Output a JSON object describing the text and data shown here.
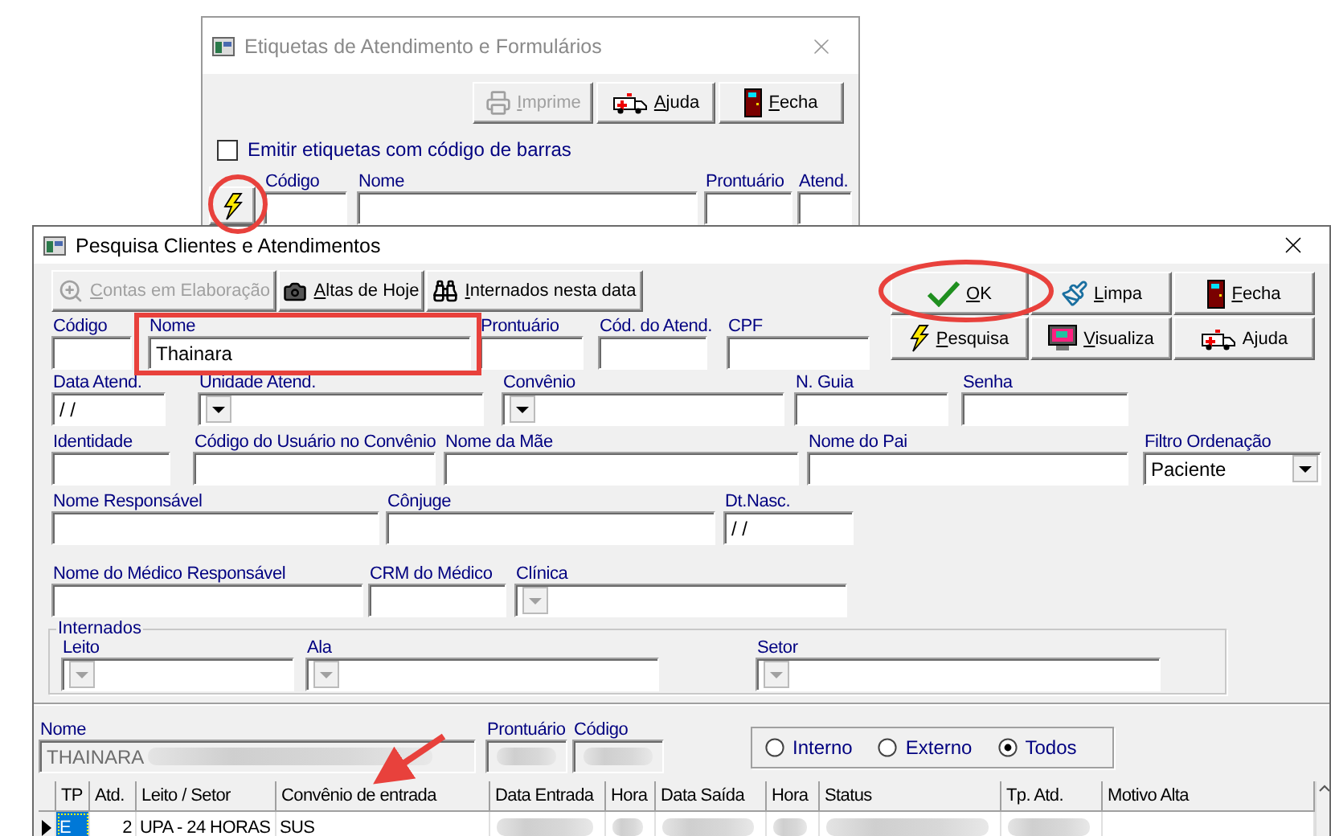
{
  "back_window": {
    "title": "Etiquetas de Atendimento e Formulários",
    "active": false,
    "buttons": [
      {
        "label": "Imprime",
        "disabled": true,
        "access_key": true
      },
      {
        "label": "Ajuda",
        "disabled": false,
        "access_key": true
      },
      {
        "label": "Fecha",
        "disabled": false,
        "access_key": true
      }
    ],
    "checkbox": {
      "label": "Emitir etiquetas com código de barras",
      "checked": false
    },
    "fields": [
      {
        "label": "Código"
      },
      {
        "label": "Nome"
      },
      {
        "label": "Prontuário"
      },
      {
        "label": "Atend."
      }
    ]
  },
  "front_window": {
    "title": "Pesquisa Clientes e Atendimentos",
    "active": true,
    "toolbar": [
      {
        "label": "Contas em Elaboração",
        "disabled": true,
        "access_key": true
      },
      {
        "label": "Altas de Hoje",
        "disabled": false,
        "access_key": true
      },
      {
        "label": "Internados nesta data",
        "disabled": false,
        "access_key": true
      }
    ],
    "actions": [
      {
        "label": "OK",
        "disabled": false,
        "access_key": true
      },
      {
        "label": "Limpa",
        "disabled": false,
        "access_key": true
      },
      {
        "label": "Fecha",
        "disabled": false,
        "access_key": true
      },
      {
        "label": "Pesquisa",
        "disabled": false,
        "access_key": true
      },
      {
        "label": "Visualiza",
        "disabled": false,
        "access_key": true
      },
      {
        "label": "Ajuda",
        "disabled": false,
        "access_key": false
      }
    ],
    "form_rows": [
      [
        {
          "label": "Código",
          "kind": "text"
        },
        {
          "label": "Nome",
          "kind": "text",
          "value": "Thainara"
        },
        {
          "label": "Prontuário",
          "kind": "text"
        },
        {
          "label": "Cód. do Atend.",
          "kind": "text"
        },
        {
          "label": "CPF",
          "kind": "text"
        }
      ],
      [
        {
          "label": "Data Atend.",
          "kind": "text",
          "value": "/ /"
        },
        {
          "label": "Unidade Atend.",
          "kind": "combo",
          "disabled": false
        },
        {
          "label": "Convênio",
          "kind": "combo",
          "disabled": false
        },
        {
          "label": "N. Guia",
          "kind": "text"
        },
        {
          "label": "Senha",
          "kind": "text"
        }
      ],
      [
        {
          "label": "Identidade",
          "kind": "text"
        },
        {
          "label": "Código do Usuário no Convênio",
          "kind": "text"
        },
        {
          "label": "Nome da Mãe",
          "kind": "text"
        },
        {
          "label": "Nome do Pai",
          "kind": "text"
        },
        {
          "label": "Filtro Ordenação",
          "kind": "combo",
          "value": "Paciente",
          "disabled": false
        }
      ],
      [
        {
          "label": "Nome Responsável",
          "kind": "text"
        },
        {
          "label": "Cônjuge",
          "kind": "text"
        },
        {
          "label": "Dt.Nasc.",
          "kind": "text",
          "value": "/ /"
        }
      ],
      [
        {
          "label": "Nome do Médico Responsável",
          "kind": "text"
        },
        {
          "label": "CRM do Médico",
          "kind": "text"
        },
        {
          "label": "Clínica",
          "kind": "combo",
          "disabled": true
        }
      ]
    ],
    "internados": {
      "title": "Internados",
      "fields": [
        {
          "label": "Leito",
          "kind": "combo",
          "disabled": true
        },
        {
          "label": "Ala",
          "kind": "combo",
          "disabled": true
        },
        {
          "label": "Setor",
          "kind": "combo",
          "disabled": true
        }
      ]
    },
    "patient": [
      {
        "label": "Nome",
        "kind": "text",
        "value": "THAINARA",
        "blurred": true,
        "disabled": true
      },
      {
        "label": "Prontuário",
        "kind": "text",
        "blurred": true,
        "disabled": true
      },
      {
        "label": "Código",
        "kind": "text",
        "blurred": true,
        "disabled": true
      }
    ],
    "filter": [
      {
        "label": "Interno",
        "selected": false
      },
      {
        "label": "Externo",
        "selected": false
      },
      {
        "label": "Todos",
        "selected": true
      }
    ],
    "grid": {
      "columns": [
        "TP",
        "Atd.",
        "Leito / Setor",
        "Convênio de entrada",
        "Data Entrada",
        "Hora",
        "Data Saída",
        "Hora",
        "Status",
        "Tp. Atd.",
        "Motivo Alta"
      ],
      "rows": [
        {
          "current": true,
          "cells": [
            {
              "text": "E",
              "selected": true,
              "blurred": false
            },
            {
              "text": "2",
              "selected": false,
              "blurred": false
            },
            {
              "text": "UPA - 24 HORAS",
              "selected": false,
              "blurred": false
            },
            {
              "text": "SUS",
              "selected": false,
              "blurred": false
            },
            {
              "selected": false,
              "blurred": true
            },
            {
              "selected": false,
              "blurred": true
            },
            {
              "selected": false,
              "blurred": true
            },
            {
              "selected": false,
              "blurred": true
            },
            {
              "selected": false,
              "blurred": true
            },
            {
              "selected": false,
              "blurred": true
            },
            {
              "selected": false,
              "blurred": false
            }
          ]
        }
      ]
    }
  },
  "annotations": [
    {
      "kind": "ellipse"
    },
    {
      "kind": "ellipse"
    },
    {
      "kind": "rectangle"
    },
    {
      "kind": "arrow"
    }
  ]
}
